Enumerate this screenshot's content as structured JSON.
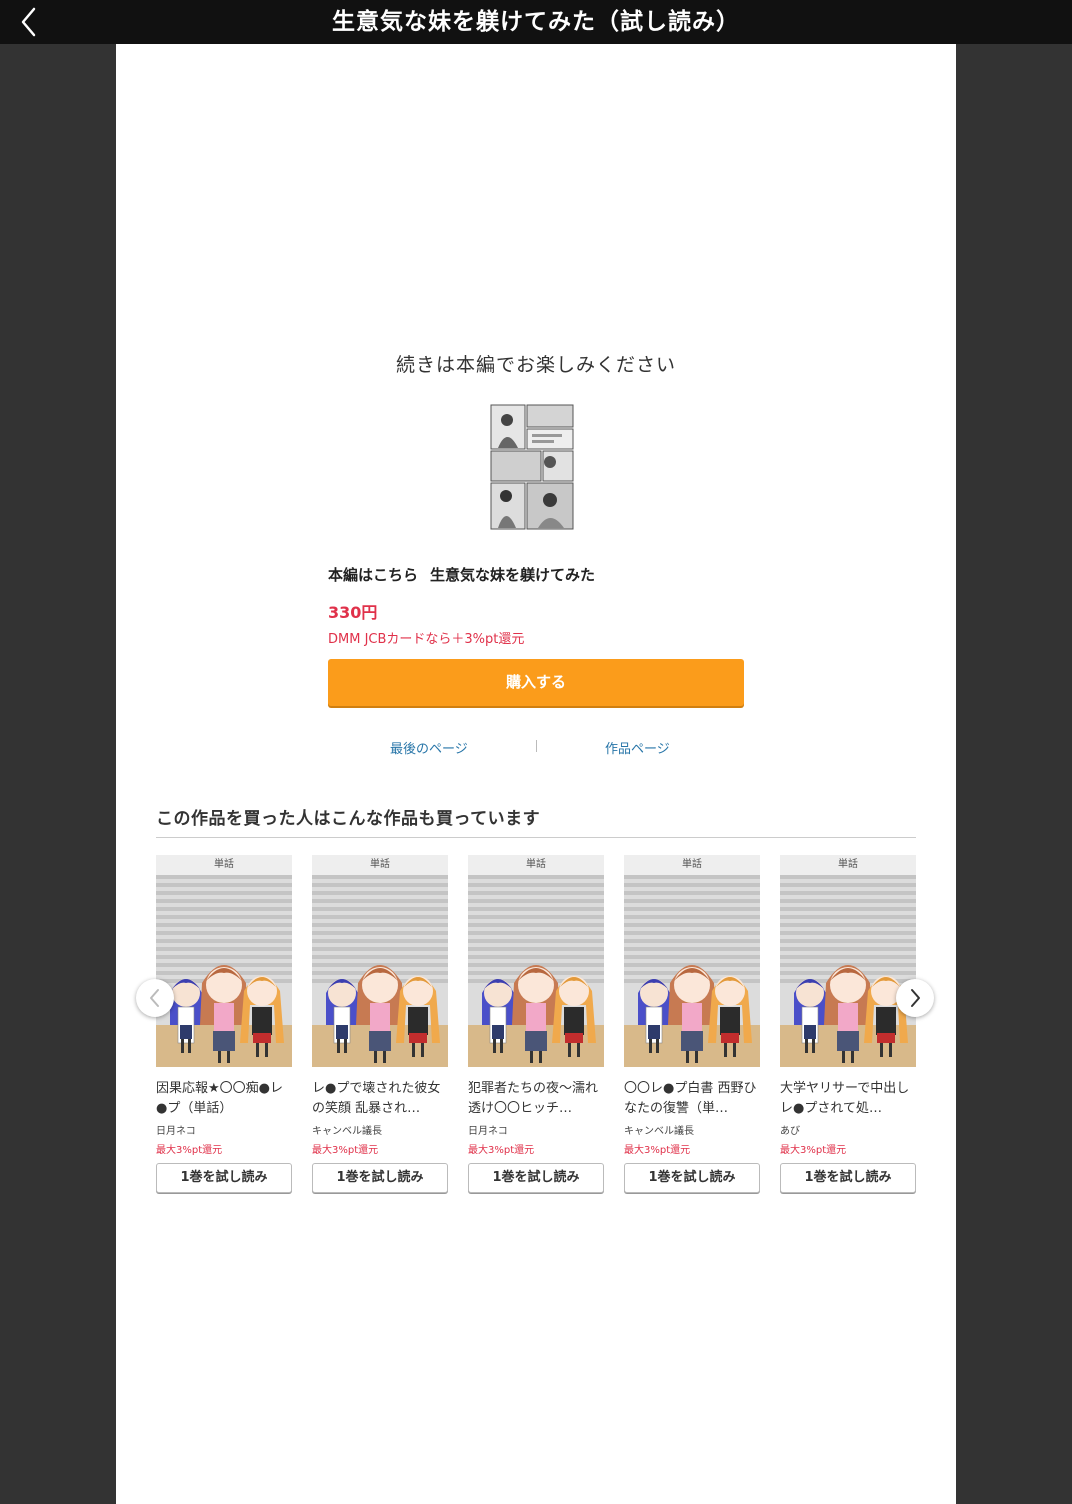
{
  "header": {
    "title": "生意気な妹を躾けてみた（試し読み）",
    "back_icon": "chevron-left-icon"
  },
  "end_panel": {
    "continue_message": "続きは本編でお楽しみください",
    "main_label": "本編はこちら",
    "main_title": "生意気な妹を躾けてみた",
    "price": "330円",
    "points_note": "DMM JCBカードなら＋3%pt還元",
    "buy_label": "購入する",
    "last_page_link": "最後のページ",
    "work_page_link": "作品ページ"
  },
  "recommend": {
    "heading": "この作品を買った人はこんな作品も買っています",
    "items": [
      {
        "tag": "単話",
        "title": "因果応報★〇〇痴●レ●プ（単話）",
        "author": "日月ネコ",
        "points": "最大3%pt還元",
        "button": "1巻を試し読み"
      },
      {
        "tag": "単話",
        "title": "レ●プで壊された彼女の笑顔 乱暴され…",
        "author": "キャンベル議長",
        "points": "最大3%pt還元",
        "button": "1巻を試し読み"
      },
      {
        "tag": "単話",
        "title": "犯罪者たちの夜〜濡れ透け〇〇ヒッチ…",
        "author": "日月ネコ",
        "points": "最大3%pt還元",
        "button": "1巻を試し読み"
      },
      {
        "tag": "単話",
        "title": "〇〇レ●プ白書 西野ひなたの復讐（単…",
        "author": "キャンベル議長",
        "points": "最大3%pt還元",
        "button": "1巻を試し読み"
      },
      {
        "tag": "単話",
        "title": "大学ヤリサーで中出しレ●プされて処…",
        "author": "あび",
        "points": "最大3%pt還元",
        "button": "1巻を試し読み"
      }
    ]
  },
  "colors": {
    "accent": "#fb9c1b",
    "price": "#e0314a",
    "link": "#2775a8"
  }
}
